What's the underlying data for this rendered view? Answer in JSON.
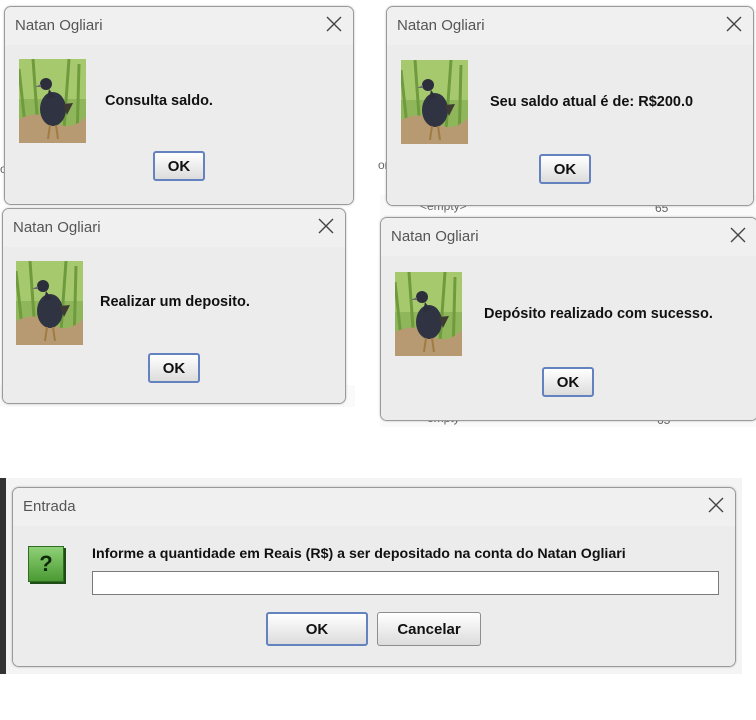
{
  "dialogs": [
    {
      "title": "Natan Ogliari",
      "message": "Consulta saldo.",
      "ok_label": "OK"
    },
    {
      "title": "Natan Ogliari",
      "message": "Seu saldo atual é de: R$200.0",
      "ok_label": "OK"
    },
    {
      "title": "Natan Ogliari",
      "message": "Realizar um deposito.",
      "ok_label": "OK"
    },
    {
      "title": "Natan Ogliari",
      "message": "Depósito realizado com sucesso.",
      "ok_label": "OK"
    }
  ],
  "input_dialog": {
    "title": "Entrada",
    "prompt": "Informe a quantidade em Reais (R$) a ser depositado na conta do Natan Ogliari",
    "value": "",
    "ok_label": "OK",
    "cancel_label": "Cancelar"
  },
  "background": {
    "empty_label": "<empty>",
    "number_label": "65"
  },
  "icons": {
    "message_icon": "bird-photo-icon",
    "input_icon": "question-icon",
    "close": "close-icon"
  },
  "colors": {
    "dialog_bg": "#f0f0f0",
    "button_border_focus": "#6382bf",
    "question_icon": "#5aa83f"
  }
}
